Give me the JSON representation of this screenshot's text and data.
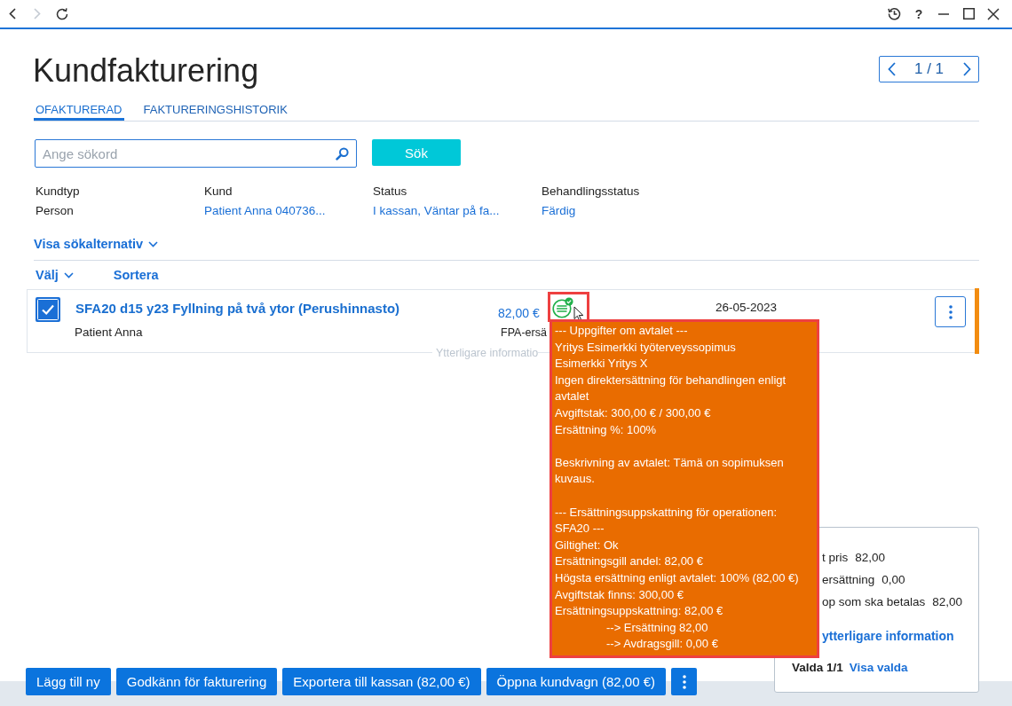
{
  "window": {
    "nav": [
      {
        "kind": "back",
        "disabled": false
      },
      {
        "kind": "forward",
        "disabled": true
      },
      {
        "kind": "refresh",
        "disabled": false
      }
    ],
    "controls": [
      {
        "kind": "history"
      },
      {
        "kind": "help",
        "label": "?"
      },
      {
        "kind": "minimize"
      },
      {
        "kind": "maximize"
      },
      {
        "kind": "close"
      }
    ]
  },
  "page": {
    "title": "Kundfakturering",
    "pager": "1 / 1"
  },
  "tabs": [
    {
      "label": "OFAKTURERAD",
      "selected": true
    },
    {
      "label": "FAKTURERINGSHISTORIK",
      "selected": false
    }
  ],
  "search": {
    "placeholder": "Ange sökord",
    "button": "Sök"
  },
  "filters": [
    {
      "label": "Kundtyp",
      "value": "Person",
      "kind": "text"
    },
    {
      "label": "Kund",
      "value": "Patient Anna 040736...",
      "kind": "link"
    },
    {
      "label": "Status",
      "value": "I kassan, Väntar på fa...",
      "kind": "link"
    },
    {
      "label": "Behandlingsstatus",
      "value": "Färdig",
      "kind": "link"
    }
  ],
  "search_options_toggle": "Visa sökalternativ",
  "list_toolbar": {
    "select": "Välj",
    "sort": "Sortera"
  },
  "rows": [
    {
      "checked": true,
      "title": "SFA20 d15 y23 Fyllning på två ytor (Perushinnasto)",
      "customer": "Patient Anna",
      "price": "82,00 €",
      "reimbursement": "FPA-ersä",
      "date": "26-05-2023",
      "more_info": "Ytterligare informatio",
      "color": "#f28c10"
    }
  ],
  "tooltip": {
    "sections": [
      {
        "lines": [
          {
            "kind": "plain",
            "text": "--- Uppgifter om avtalet ---"
          },
          {
            "kind": "plain",
            "text": "Yritys Esimerkki työterveyssopimus"
          },
          {
            "kind": "plain",
            "text": "Esimerkki Yritys X"
          },
          {
            "kind": "plain",
            "text": "Ingen direktersättning för behandlingen enligt avtalet"
          },
          {
            "kind": "plain",
            "text": "Avgiftstak: 300,00 € / 300,00 €"
          },
          {
            "kind": "plain",
            "text": "Ersättning %: 100%"
          }
        ]
      },
      {
        "lines": [
          {
            "kind": "plain",
            "text": "Beskrivning av avtalet: Tämä on sopimuksen kuvaus."
          }
        ]
      },
      {
        "lines": [
          {
            "kind": "plain",
            "text": "--- Ersättningsuppskattning för operationen: SFA20 ---"
          },
          {
            "kind": "plain",
            "text": "Giltighet: Ok"
          },
          {
            "kind": "plain",
            "text": "Ersättningsgill andel: 82,00 €"
          },
          {
            "kind": "plain",
            "text": "Högsta ersättning enligt avtalet: 100% (82,00 €)"
          },
          {
            "kind": "plain",
            "text": "Avgiftstak finns: 300,00 €"
          },
          {
            "kind": "plain",
            "text": "Ersättningsuppskattning: 82,00 €"
          },
          {
            "kind": "indented",
            "text": "--> Ersättning 82,00"
          },
          {
            "kind": "indented",
            "text": "--> Avdragsgill: 0,00 €"
          }
        ]
      }
    ]
  },
  "summary": {
    "rows": [
      {
        "label": "t pris",
        "value": "82,00"
      },
      {
        "label": "ersättning",
        "value": "0,00"
      },
      {
        "label": "op som ska betalas",
        "value": "82,00"
      }
    ],
    "link": "ytterligare information",
    "selection": "Valda 1/1",
    "show_selected": "Visa valda"
  },
  "actions": [
    "Lägg till ny",
    "Godkänn för fakturering",
    "Exportera till kassan (82,00 €)",
    "Öppna kundvagn (82,00 €)"
  ]
}
